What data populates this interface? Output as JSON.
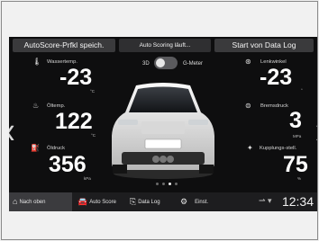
{
  "top_buttons": {
    "save": "AutoScore-Prfkl speich.",
    "status": "Auto Scoring läuft...",
    "start": "Start von Data Log"
  },
  "toggle": {
    "left_label": "3D",
    "right_label": "G-Meter"
  },
  "panels": {
    "water_temp": {
      "label": "Wassertemp.",
      "value": "-23",
      "unit": "°C",
      "icon": "water-temperature-icon"
    },
    "oil_temp": {
      "label": "Öltemp.",
      "value": "122",
      "unit": "°C",
      "icon": "oil-temperature-icon"
    },
    "oil_pressure": {
      "label": "Öldruck",
      "value": "356",
      "unit": "kPa",
      "icon": "oil-pressure-icon"
    },
    "steering_angle": {
      "label": "Lenkwinkel",
      "value": "-23",
      "unit": "°",
      "icon": "steering-wheel-icon"
    },
    "brake_pressure": {
      "label": "Bremsdruck",
      "value": "3",
      "unit": "MPa",
      "icon": "brake-icon"
    },
    "clutch_pos": {
      "label": "Kupplungs-stell.",
      "value": "75",
      "unit": "%",
      "icon": "clutch-pedal-icon"
    }
  },
  "pager": {
    "count": 4,
    "active": 2
  },
  "bottom_bar": {
    "tabs": [
      {
        "label": "Nach oben",
        "icon": "home-icon"
      },
      {
        "label": "Auto Score",
        "icon": "car-icon"
      },
      {
        "label": "Data Log",
        "icon": "data-log-icon"
      },
      {
        "label": "Einst.",
        "icon": "gear-icon"
      }
    ],
    "time": "12:34"
  }
}
